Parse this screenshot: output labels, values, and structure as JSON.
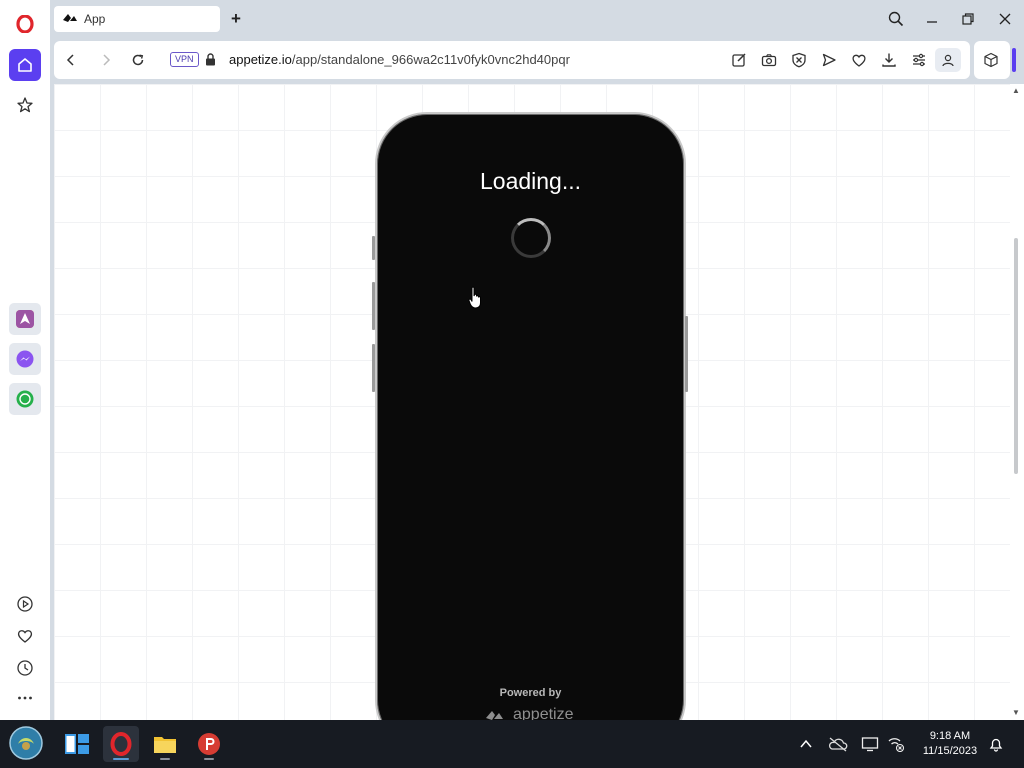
{
  "browser": {
    "tab_title": "App",
    "new_tab_symbol": "+",
    "vpn_label": "VPN",
    "url_host": "appetize.io",
    "url_path": "/app/standalone_966wa2c11v0fyk0vnc2hd40pqr"
  },
  "sidebar": {
    "items": [
      "opera-logo",
      "home",
      "speed-dial-star",
      "aria",
      "messenger",
      "whatsapp",
      "player",
      "favorites-heart",
      "history-clock",
      "more-dots"
    ]
  },
  "page": {
    "loading_text": "Loading...",
    "powered_by": "Powered by",
    "brand": "appetize"
  },
  "taskbar": {
    "time": "9:18 AM",
    "date": "11/15/2023"
  },
  "colors": {
    "accent": "#5b3ff0",
    "phone_screen": "#0a0a0a",
    "taskbar": "#171b22"
  }
}
